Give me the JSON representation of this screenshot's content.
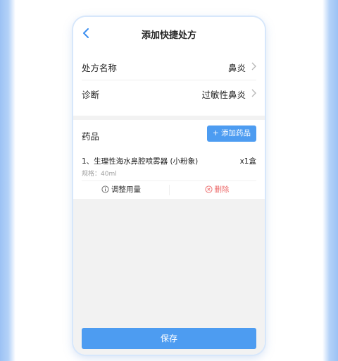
{
  "nav": {
    "title": "添加快捷处方"
  },
  "form": {
    "rows": [
      {
        "label": "处方名称",
        "value": "鼻炎"
      },
      {
        "label": "诊断",
        "value": "过敏性鼻炎"
      }
    ]
  },
  "medicines": {
    "title": "药品",
    "add_label": "+ 添加药品",
    "items": [
      {
        "name": "1、生理性海水鼻腔喷雾器 (小粉象)",
        "quantity": "x1盒",
        "spec": "规格：40ml"
      }
    ],
    "actions": {
      "adjust_label": "调整用量",
      "delete_label": "删除"
    }
  },
  "footer": {
    "save_label": "保存"
  },
  "colors": {
    "accent": "#4d9cf1",
    "danger": "#ec6a6a",
    "background": "#f2f2f2"
  },
  "icons": {
    "back": "chevron-left-icon",
    "row_arrow": "chevron-right-icon",
    "adjust": "info-circle-icon",
    "delete": "close-circle-icon"
  }
}
